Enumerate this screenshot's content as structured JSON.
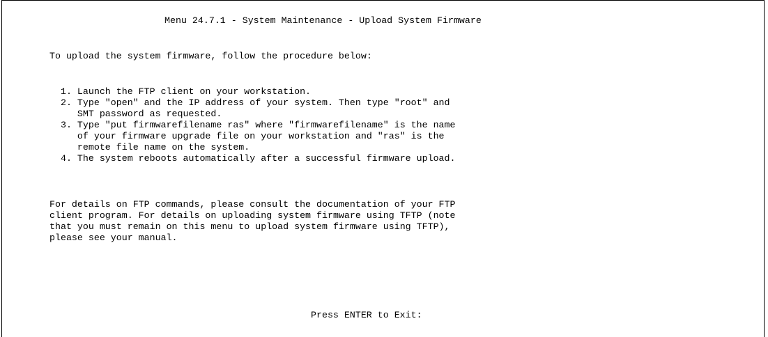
{
  "menu": {
    "title": "Menu 24.7.1 - System Maintenance - Upload System Firmware",
    "intro": "To upload the system firmware, follow the procedure below:",
    "steps": [
      "  1. Launch the FTP client on your workstation.",
      "  2. Type \"open\" and the IP address of your system. Then type \"root\" and",
      "     SMT password as requested.",
      "  3. Type \"put firmwarefilename ras\" where \"firmwarefilename\" is the name",
      "     of your firmware upgrade file on your workstation and \"ras\" is the",
      "     remote file name on the system.",
      "  4. The system reboots automatically after a successful firmware upload."
    ],
    "details": [
      "For details on FTP commands, please consult the documentation of your FTP",
      "client program. For details on uploading system firmware using TFTP (note",
      "that you must remain on this menu to upload system firmware using TFTP),",
      "please see your manual."
    ],
    "prompt": "Press ENTER to Exit:"
  }
}
